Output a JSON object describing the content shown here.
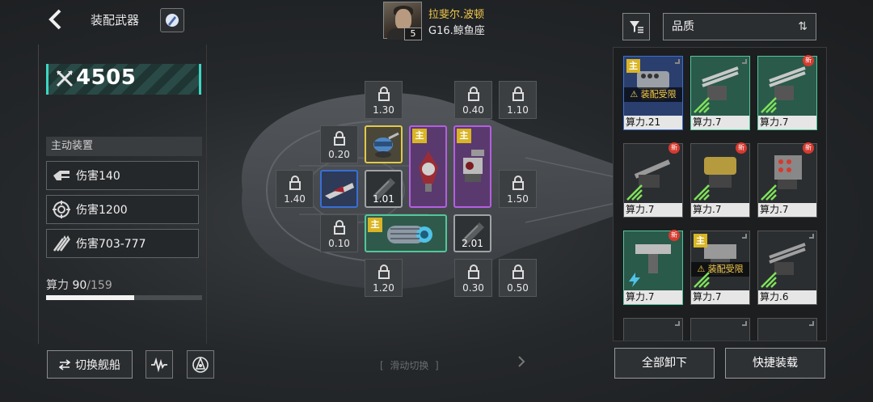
{
  "header": {
    "title": "装配武器",
    "pilot": {
      "name": "拉斐尔.波顿",
      "ship": "G16.鲸鱼座",
      "level": "5"
    }
  },
  "left": {
    "combat_power": "4505",
    "active_header": "主动装置",
    "damage_rows": [
      {
        "label": "伤害140",
        "icon": "gatling-icon"
      },
      {
        "label": "伤害1200",
        "icon": "target-icon"
      },
      {
        "label": "伤害703-777",
        "icon": "missile-icon"
      }
    ],
    "capacity_label": "算力",
    "capacity_current": "90",
    "capacity_max": "/159",
    "capacity_fraction": 0.566,
    "switch_ship_label": "切换舰船"
  },
  "center": {
    "swipe_hint": "滑动切换",
    "locked_slots": [
      "1.30",
      "0.40",
      "1.10",
      "0.20",
      "1.40",
      "1.50",
      "0.10",
      "1.20",
      "0.30",
      "0.50"
    ],
    "equipped": [
      {
        "value": "1.01",
        "main": false
      },
      {
        "value": "2.01",
        "main": false
      }
    ],
    "main_tag": "主"
  },
  "right": {
    "sort_label": "品质",
    "cards": [
      {
        "label": "算力.21",
        "main": true,
        "restricted": "装配受限",
        "new": false,
        "rarity": "blue"
      },
      {
        "label": "算力.7",
        "main": false,
        "new": false,
        "rarity": "teal"
      },
      {
        "label": "算力.7",
        "main": false,
        "new": true,
        "rarity": "teal"
      },
      {
        "label": "算力.7",
        "main": false,
        "new": true,
        "rarity": "gray"
      },
      {
        "label": "算力.7",
        "main": false,
        "new": true,
        "rarity": "gray"
      },
      {
        "label": "算力.7",
        "main": false,
        "new": true,
        "rarity": "gray"
      },
      {
        "label": "算力.7",
        "main": false,
        "new": true,
        "rarity": "teal"
      },
      {
        "label": "算力.7",
        "main": true,
        "restricted": "装配受限",
        "new": false,
        "rarity": "gray"
      },
      {
        "label": "算力.6",
        "main": false,
        "new": false,
        "rarity": "gray"
      }
    ],
    "new_badge": "新",
    "unload_all_label": "全部卸下",
    "quick_equip_label": "快捷装载"
  }
}
